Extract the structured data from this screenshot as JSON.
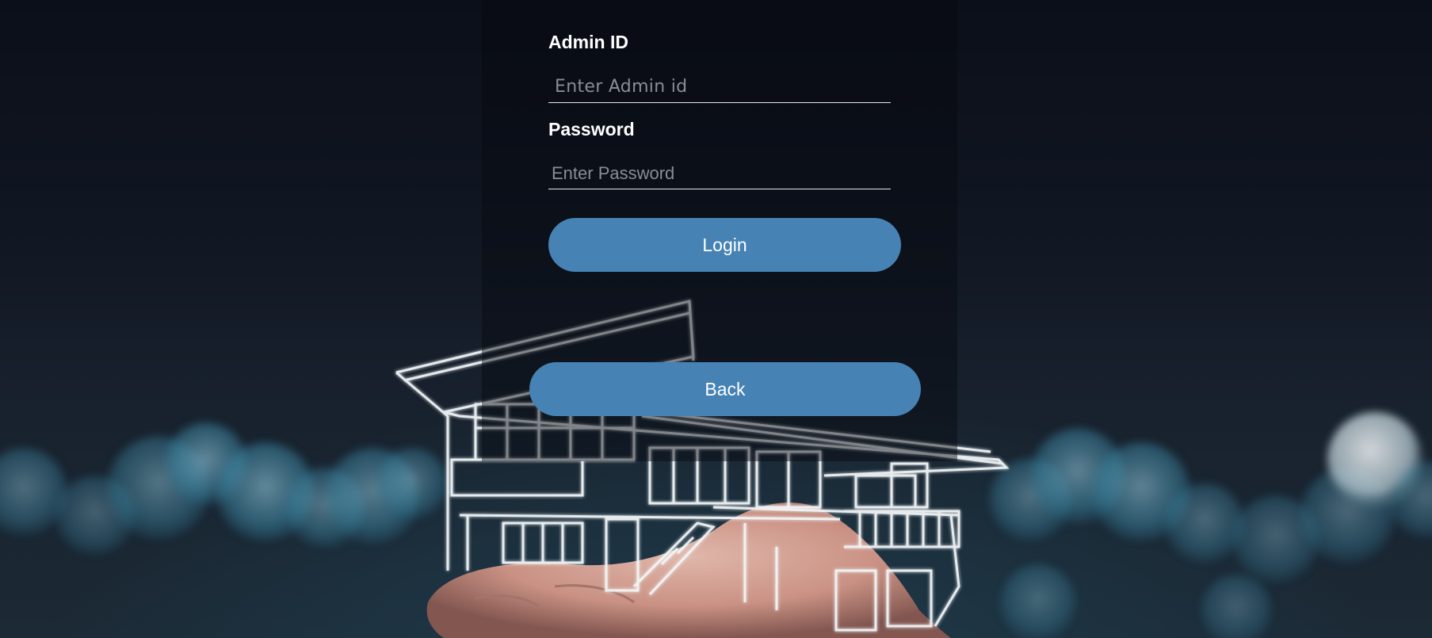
{
  "form": {
    "admin_label": "Admin ID",
    "admin_placeholder": "Enter Admin id",
    "admin_value": "",
    "password_label": "Password",
    "password_placeholder": "Enter Password",
    "password_value": "",
    "login_label": "Login",
    "back_label": "Back"
  },
  "colors": {
    "button_bg": "#4682b4",
    "button_text": "#ffffff",
    "label_text": "#ffffff",
    "placeholder_text": "#8a8d93"
  },
  "background": {
    "image_subject": "hand holding glowing wireframe house over blue bokeh lights"
  }
}
